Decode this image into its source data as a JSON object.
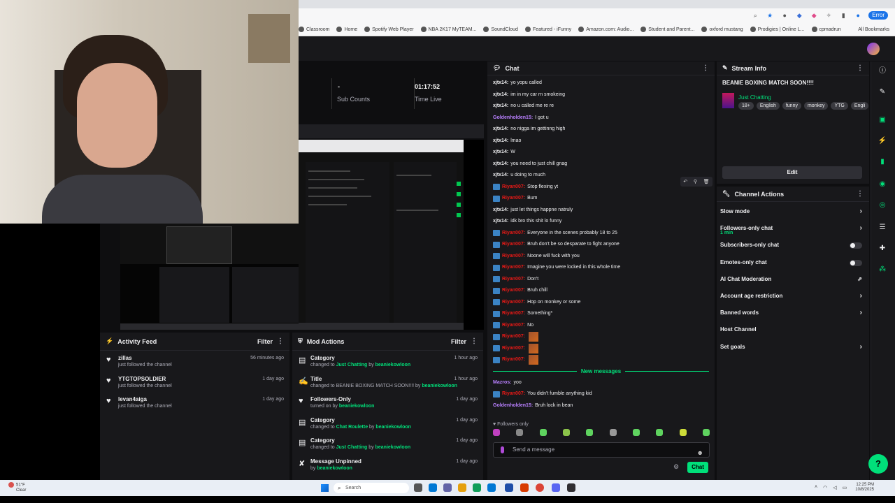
{
  "browser": {
    "profile_label": "Error",
    "bookmarks": [
      "Classroom",
      "Home",
      "Spotify Web Player",
      "NBA 2K17 MyTEAM...",
      "SoundCloud",
      "Featured - iFunny",
      "Amazon.com: Audio...",
      "Student and Parent...",
      "oxford mustang",
      "Prodigies | Online L...",
      "cpmadrun"
    ],
    "all_bookmarks": "All Bookmarks"
  },
  "stats": {
    "sub_counts_value": "-",
    "sub_counts_label": "Sub Counts",
    "time_live_value": "01:17:52",
    "time_live_label": "Time Live"
  },
  "activity_feed": {
    "title": "Activity Feed",
    "filter": "Filter",
    "items": [
      {
        "name": "zillas",
        "sub": "just followed the channel",
        "time": "56 minutes ago",
        "icon": "heart-icon"
      },
      {
        "name": "YTGTOPSOLDIER",
        "sub": "just followed the channel",
        "time": "1 day ago",
        "icon": "heart-icon"
      },
      {
        "name": "levan4aiga",
        "sub": "just followed the channel",
        "time": "1 day ago",
        "icon": "heart-icon"
      }
    ]
  },
  "mod_actions": {
    "title": "Mod Actions",
    "filter": "Filter",
    "items": [
      {
        "action": "Category",
        "pre": "changed to ",
        "hl": "Just Chatting",
        "mid": " by ",
        "by": "beaniekowloon",
        "time": "1 hour ago",
        "icon": "clipboard-icon"
      },
      {
        "action": "Title",
        "pre": "changed to BEANIE BOXING MATCH SOON!!!! by ",
        "hl": "",
        "mid": "",
        "by": "beaniekowloon",
        "time": "1 hour ago",
        "icon": "text-icon"
      },
      {
        "action": "Followers-Only",
        "pre": "turned on by ",
        "hl": "",
        "mid": "",
        "by": "beaniekowloon",
        "time": "1 day ago",
        "icon": "heart-icon"
      },
      {
        "action": "Category",
        "pre": "changed to ",
        "hl": "Chat Roulette",
        "mid": " by ",
        "by": "beaniekowloon",
        "time": "1 day ago",
        "icon": "clipboard-icon"
      },
      {
        "action": "Category",
        "pre": "changed to ",
        "hl": "Just Chatting",
        "mid": " by ",
        "by": "beaniekowloon",
        "time": "1 day ago",
        "icon": "clipboard-icon"
      },
      {
        "action": "Message Unpinned",
        "pre": "by ",
        "hl": "",
        "mid": "",
        "by": "beaniekowloon",
        "time": "1 day ago",
        "icon": "unpin-icon"
      }
    ]
  },
  "chat": {
    "title": "Chat",
    "messages": [
      {
        "user": "xjtx14:",
        "text": "yo yopu called",
        "color": "#efeff1",
        "badge": false
      },
      {
        "user": "xjtx14:",
        "text": "im in my car rn smokeing",
        "color": "#efeff1",
        "badge": false
      },
      {
        "user": "xjtx14:",
        "text": "no u called me re re",
        "color": "#efeff1",
        "badge": false
      },
      {
        "user": "Goldenholden15:",
        "text": "I got u",
        "color": "#b980ff",
        "badge": false
      },
      {
        "user": "xjtx14:",
        "text": "no nigga im gettinng high",
        "color": "#efeff1",
        "badge": false
      },
      {
        "user": "xjtx14:",
        "text": "lmao",
        "color": "#efeff1",
        "badge": false
      },
      {
        "user": "xjtx14:",
        "text": "W",
        "color": "#efeff1",
        "badge": false
      },
      {
        "user": "xjtx14:",
        "text": "you need to just chill gnag",
        "color": "#efeff1",
        "badge": false
      },
      {
        "user": "xjtx14:",
        "text": "u doing to much",
        "color": "#efeff1",
        "badge": false
      },
      {
        "user": "Riyan007:",
        "text": "Stop flexing yt",
        "color": "#e91916",
        "badge": true
      },
      {
        "user": "Riyan007:",
        "text": "Bum",
        "color": "#e91916",
        "badge": true
      },
      {
        "user": "xjtx14:",
        "text": "just let things happne natruly",
        "color": "#efeff1",
        "badge": false
      },
      {
        "user": "xjtx14:",
        "text": "idk bro this shit lo funny",
        "color": "#efeff1",
        "badge": false
      },
      {
        "user": "Riyan007:",
        "text": "Everyone in the scenes probably 18 to 25",
        "color": "#e91916",
        "badge": true
      },
      {
        "user": "Riyan007:",
        "text": "Bruh don't be so desparate to fight anyone",
        "color": "#e91916",
        "badge": true
      },
      {
        "user": "Riyan007:",
        "text": "Noone will fuck with you",
        "color": "#e91916",
        "badge": true
      },
      {
        "user": "Riyan007:",
        "text": "Imagine you were locked in this whole time",
        "color": "#e91916",
        "badge": true
      },
      {
        "user": "Riyan007:",
        "text": "Don't",
        "color": "#e91916",
        "badge": true
      },
      {
        "user": "Riyan007:",
        "text": "Bruh chill",
        "color": "#e91916",
        "badge": true
      },
      {
        "user": "Riyan007:",
        "text": "Hop on monkey or some",
        "color": "#e91916",
        "badge": true
      },
      {
        "user": "Riyan007:",
        "text": "Something*",
        "color": "#e91916",
        "badge": true
      },
      {
        "user": "Riyan007:",
        "text": "No",
        "color": "#e91916",
        "badge": true
      },
      {
        "user": "Riyan007:",
        "text": "",
        "color": "#e91916",
        "badge": true,
        "emote": true
      },
      {
        "user": "Riyan007:",
        "text": "",
        "color": "#e91916",
        "badge": true,
        "emote": true
      },
      {
        "user": "Riyan007:",
        "text": "",
        "color": "#e91916",
        "badge": true,
        "emote": true
      }
    ],
    "new_messages_label": "New messages",
    "new_messages": [
      {
        "user": "Mazros:",
        "text": "yoo",
        "color": "#b980ff",
        "badge": false
      },
      {
        "user": "Riyan007:",
        "text": "You didn't fumble anything kid",
        "color": "#e91916",
        "badge": true
      },
      {
        "user": "Goldenholden15:",
        "text": "Bruh lock in bean",
        "color": "#b980ff",
        "badge": false
      }
    ],
    "followers_only": "Followers only",
    "input_placeholder": "Send a message",
    "send_label": "Chat"
  },
  "stream_info": {
    "header": "Stream Info",
    "title": "BEANIE BOXING MATCH SOON!!!!",
    "category": "Just Chatting",
    "tags": [
      "18+",
      "English",
      "funny",
      "monkey",
      "YTG",
      "Engli"
    ],
    "edit_label": "Edit"
  },
  "channel_actions": {
    "header": "Channel Actions",
    "items": [
      {
        "label": "Slow mode",
        "sub": "",
        "control": "chevron"
      },
      {
        "label": "Followers-only chat",
        "sub": "1 min",
        "control": "chevron"
      },
      {
        "label": "Subscribers-only chat",
        "sub": "",
        "control": "toggle"
      },
      {
        "label": "Emotes-only chat",
        "sub": "",
        "control": "toggle"
      },
      {
        "label": "AI Chat Moderation",
        "sub": "",
        "control": "external"
      },
      {
        "label": "Account age restriction",
        "sub": "",
        "control": "chevron"
      },
      {
        "label": "Banned words",
        "sub": "",
        "control": "chevron"
      },
      {
        "label": "Host Channel",
        "sub": "",
        "control": "none"
      },
      {
        "label": "Set goals",
        "sub": "",
        "control": "chevron"
      }
    ]
  },
  "taskbar": {
    "weather_temp": "51°F",
    "weather_desc": "Clear",
    "search_label": "Search",
    "time": "12:25 PM",
    "date": "10/8/2025"
  },
  "colors": {
    "accent": "#00e07a",
    "panel": "#18181b",
    "background": "#0e0e10"
  }
}
